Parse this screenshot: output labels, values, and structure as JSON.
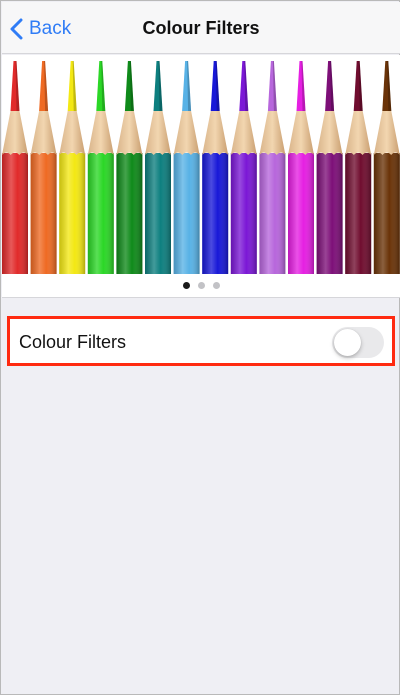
{
  "navbar": {
    "back_label": "Back",
    "title": "Colour Filters"
  },
  "preview": {
    "pencil_colors": [
      "#e12a2a",
      "#ef6a23",
      "#f3e813",
      "#2bd726",
      "#0f8a1a",
      "#0d7f7f",
      "#58b2e6",
      "#1818d8",
      "#7b17d6",
      "#b766dc",
      "#e51fe2",
      "#7d0f78",
      "#700d2f",
      "#6a3308"
    ],
    "page_count": 3,
    "active_page": 1
  },
  "settings": {
    "colour_filters_label": "Colour Filters",
    "colour_filters_on": false
  },
  "colors": {
    "accent": "#2f7cf6",
    "highlight_border": "#ff2a10"
  }
}
